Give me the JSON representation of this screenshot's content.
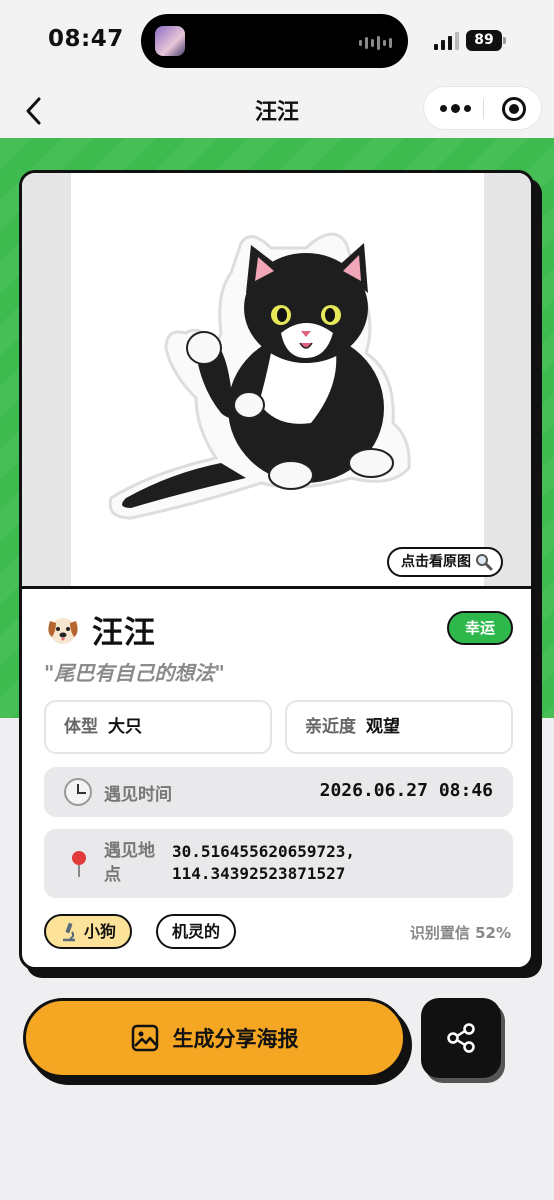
{
  "status_bar": {
    "time": "08:47",
    "battery": "89"
  },
  "nav": {
    "title": "汪汪"
  },
  "photo": {
    "view_original": "点击看原图"
  },
  "pet": {
    "name": "汪汪",
    "badge": "幸运",
    "quote": "\"尾巴有自己的想法\"",
    "stats": [
      {
        "key": "体型",
        "value": "大只"
      },
      {
        "key": "亲近度",
        "value": "观望"
      }
    ],
    "met_time_label": "遇见时间",
    "met_time_value": "2026.06.27 08:46",
    "met_place_label": "遇见地点",
    "met_place_lat": "30.516455620659723,",
    "met_place_lng": "114.34392523871527",
    "tags": [
      "小狗",
      "机灵的"
    ],
    "confidence": "识别置信 52%"
  },
  "actions": {
    "poster_label": "生成分享海报"
  },
  "colors": {
    "green": "#3dbb4f",
    "yellow": "#f5a623",
    "badge_green": "#2eb84c"
  }
}
